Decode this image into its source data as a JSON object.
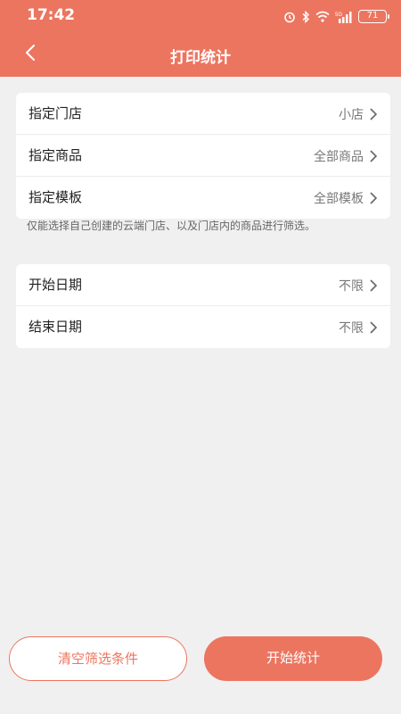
{
  "status_bar": {
    "time": "17:42",
    "network": "5G",
    "battery": "71"
  },
  "header": {
    "title": "打印统计"
  },
  "filters": [
    {
      "label": "指定门店",
      "value": "小店"
    },
    {
      "label": "指定商品",
      "value": "全部商品"
    },
    {
      "label": "指定模板",
      "value": "全部模板"
    }
  ],
  "hint": "仅能选择自己创建的云端门店、以及门店内的商品进行筛选。",
  "dates": [
    {
      "label": "开始日期",
      "value": "不限"
    },
    {
      "label": "结束日期",
      "value": "不限"
    }
  ],
  "buttons": {
    "clear": "清空筛选条件",
    "start": "开始统计"
  },
  "colors": {
    "accent": "#ec7560",
    "background": "#f0f0f0"
  }
}
